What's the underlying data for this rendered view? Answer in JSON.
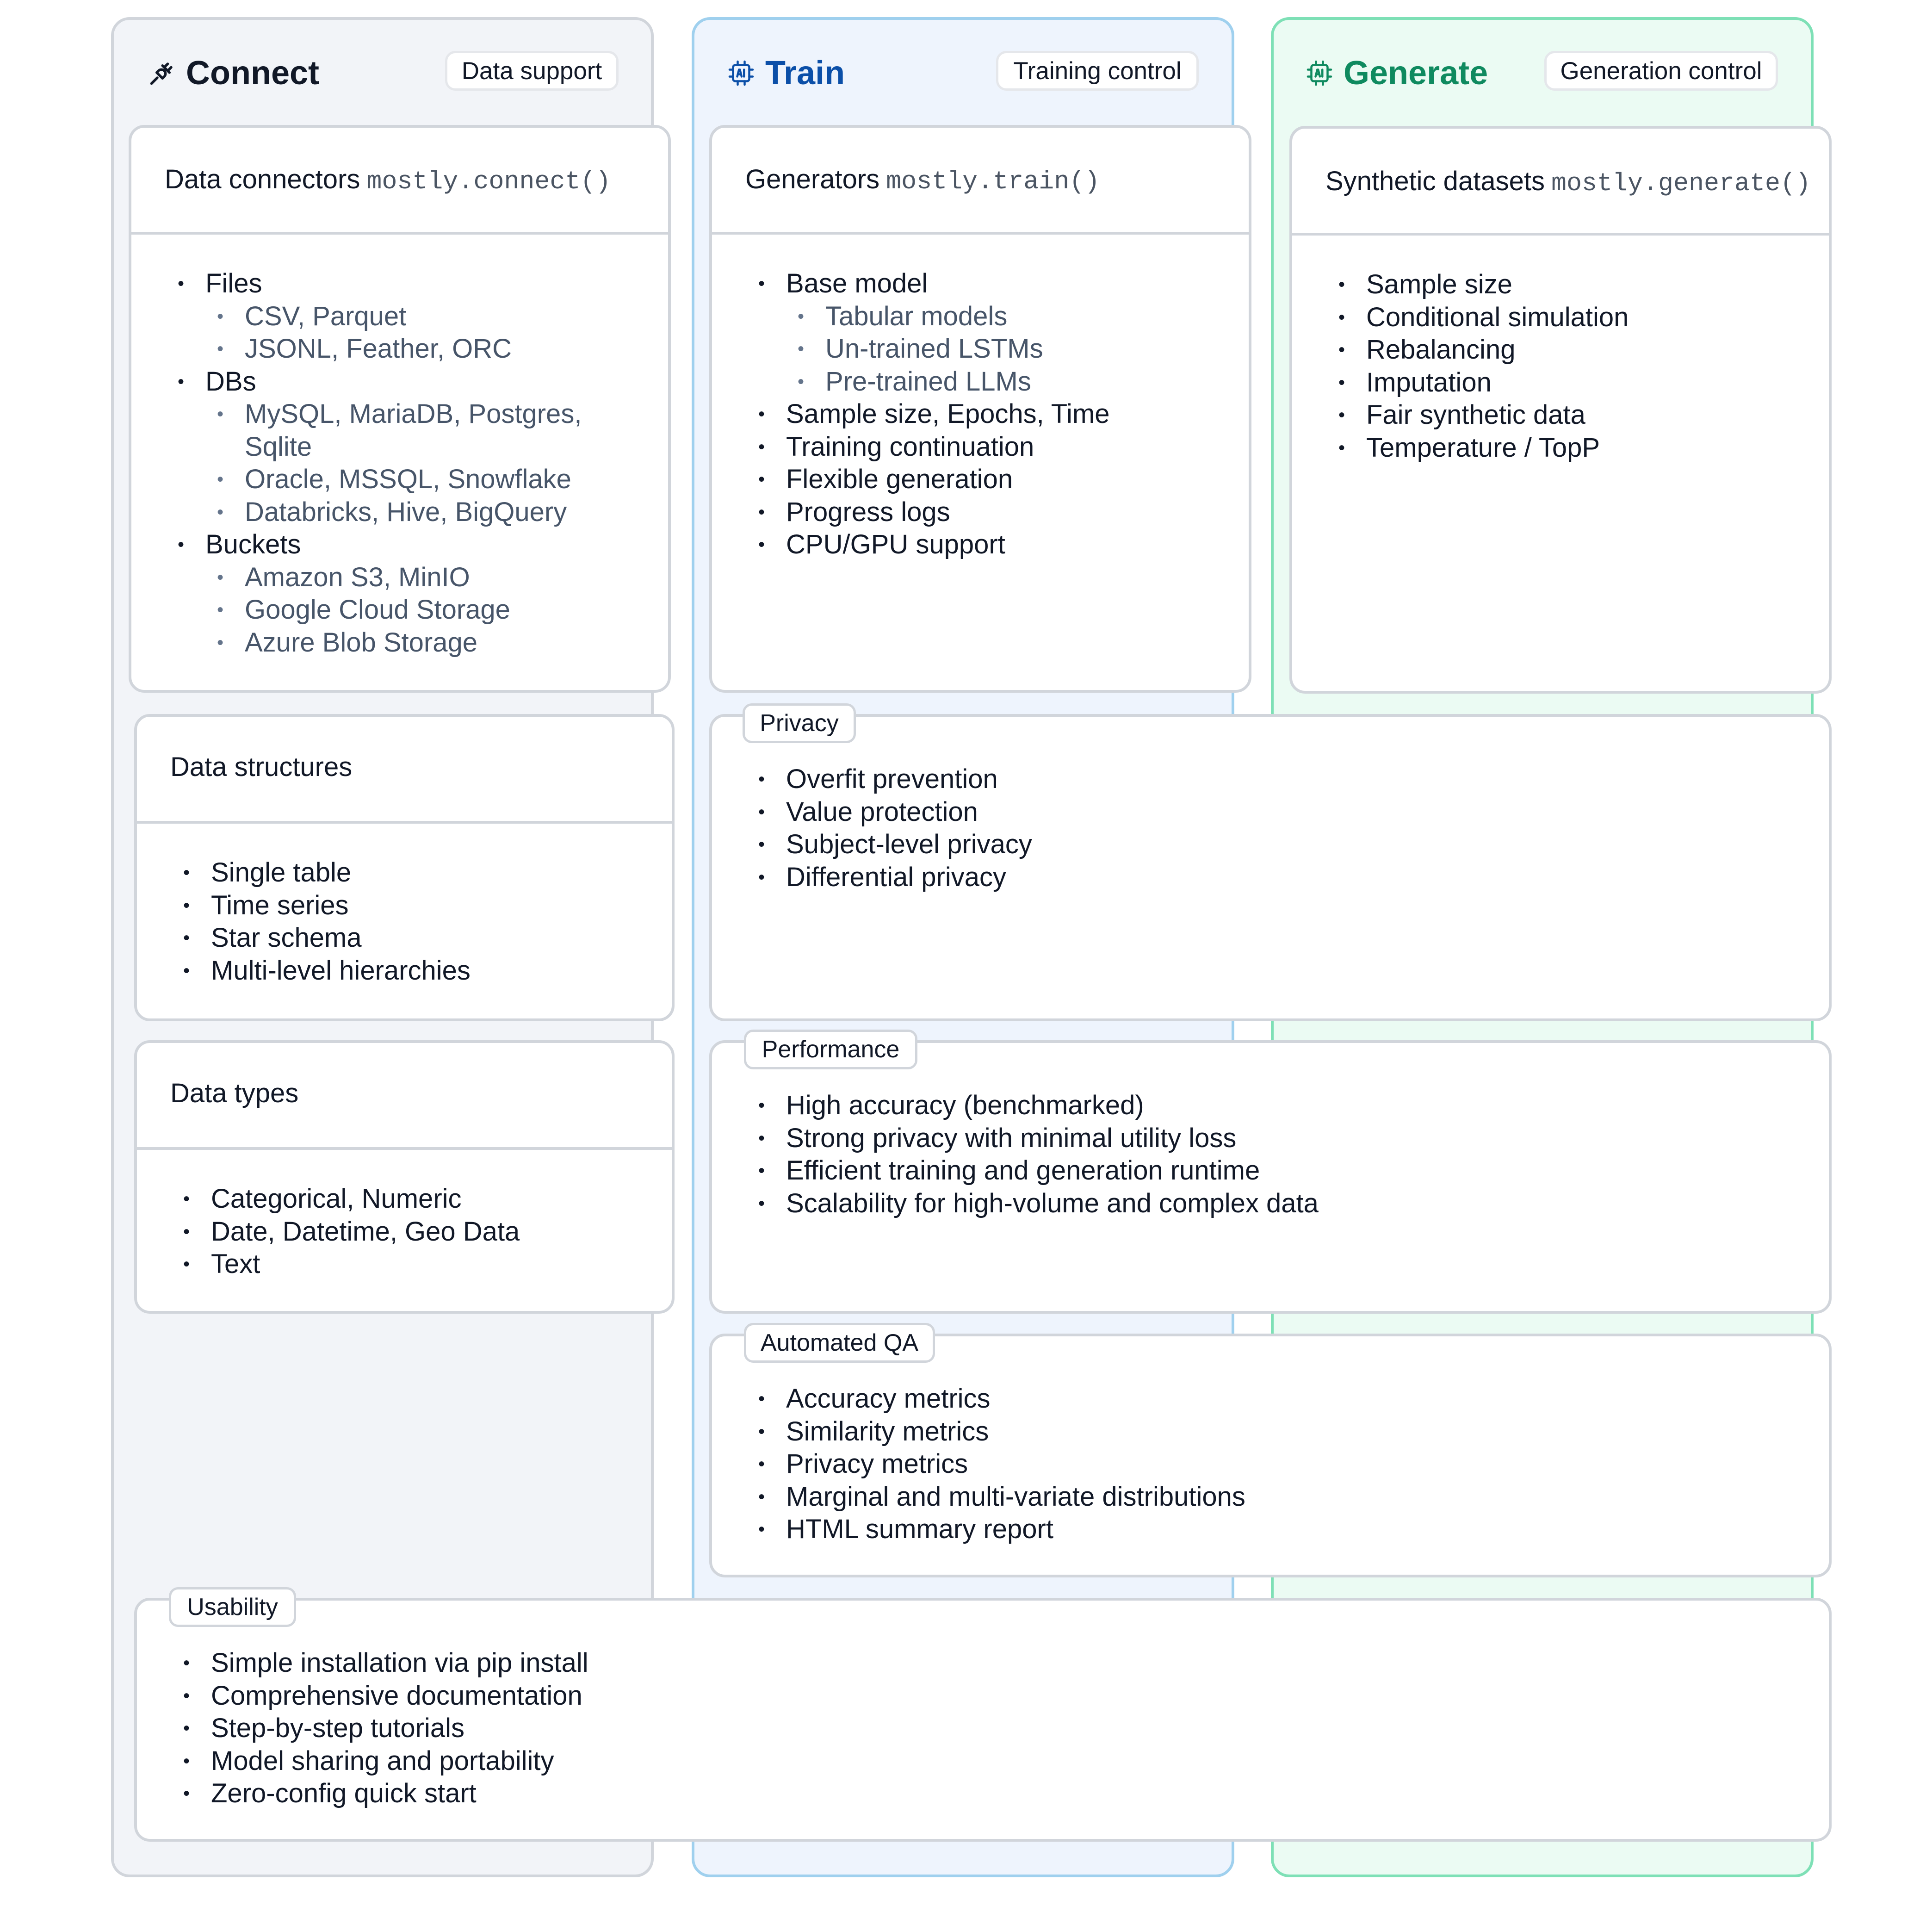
{
  "columns": {
    "connect": {
      "title": "Connect",
      "badge": "Data support",
      "icon": "plug-icon",
      "color": "#111827"
    },
    "train": {
      "title": "Train",
      "badge": "Training control",
      "icon": "ai-chip-icon",
      "color": "#0b4fa8"
    },
    "generate": {
      "title": "Generate",
      "badge": "Generation control",
      "icon": "ai-chip-icon",
      "color": "#0f8a5f"
    }
  },
  "cards": {
    "data_connectors": {
      "title": "Data connectors",
      "code": "mostly.connect()",
      "items": [
        {
          "text": "Files",
          "level": 1
        },
        {
          "text": "CSV, Parquet",
          "level": 2
        },
        {
          "text": "JSONL, Feather, ORC",
          "level": 2
        },
        {
          "text": "DBs",
          "level": 1
        },
        {
          "text": "MySQL, MariaDB, Postgres,",
          "level": 2
        },
        {
          "text": "Sqlite",
          "level": 3
        },
        {
          "text": "Oracle, MSSQL, Snowflake",
          "level": 2
        },
        {
          "text": "Databricks, Hive, BigQuery",
          "level": 2
        },
        {
          "text": "Buckets",
          "level": 1
        },
        {
          "text": "Amazon S3, MinIO",
          "level": 2
        },
        {
          "text": "Google Cloud Storage",
          "level": 2
        },
        {
          "text": "Azure Blob Storage",
          "level": 2
        }
      ]
    },
    "generators": {
      "title": "Generators",
      "code": "mostly.train()",
      "items": [
        {
          "text": "Base model",
          "level": 1
        },
        {
          "text": "Tabular models",
          "level": 2
        },
        {
          "text": "Un-trained LSTMs",
          "level": 2
        },
        {
          "text": "Pre-trained LLMs",
          "level": 2
        },
        {
          "text": "Sample size, Epochs, Time",
          "level": 1
        },
        {
          "text": "Training continuation",
          "level": 1
        },
        {
          "text": "Flexible generation",
          "level": 1
        },
        {
          "text": "Progress logs",
          "level": 1
        },
        {
          "text": "CPU/GPU support",
          "level": 1
        }
      ]
    },
    "synthetic_datasets": {
      "title": "Synthetic datasets",
      "code": "mostly.generate()",
      "items": [
        "Sample size",
        "Conditional simulation",
        "Rebalancing",
        "Imputation",
        "Fair synthetic data",
        "Temperature / TopP"
      ]
    },
    "data_structures": {
      "title": "Data structures",
      "items": [
        "Single table",
        "Time series",
        "Star schema",
        "Multi-level hierarchies"
      ]
    },
    "data_types": {
      "title": "Data types",
      "items": [
        "Categorical, Numeric",
        "Date, Datetime, Geo Data",
        "Text"
      ]
    }
  },
  "panels": {
    "privacy": {
      "tag": "Privacy",
      "items": [
        "Overfit prevention",
        "Value protection",
        "Subject-level privacy",
        "Differential privacy"
      ]
    },
    "performance": {
      "tag": "Performance",
      "items": [
        "High accuracy (benchmarked)",
        "Strong privacy with minimal utility loss",
        "Efficient training and generation runtime",
        "Scalability for high-volume and complex data"
      ]
    },
    "automated_qa": {
      "tag": "Automated QA",
      "items": [
        "Accuracy metrics",
        "Similarity metrics",
        "Privacy metrics",
        "Marginal and multi-variate distributions",
        "HTML summary report"
      ]
    },
    "usability": {
      "tag": "Usability",
      "items": [
        "Simple installation via pip install",
        "Comprehensive documentation",
        "Step-by-step tutorials",
        "Model sharing and portability",
        "Zero-config quick start"
      ]
    }
  }
}
